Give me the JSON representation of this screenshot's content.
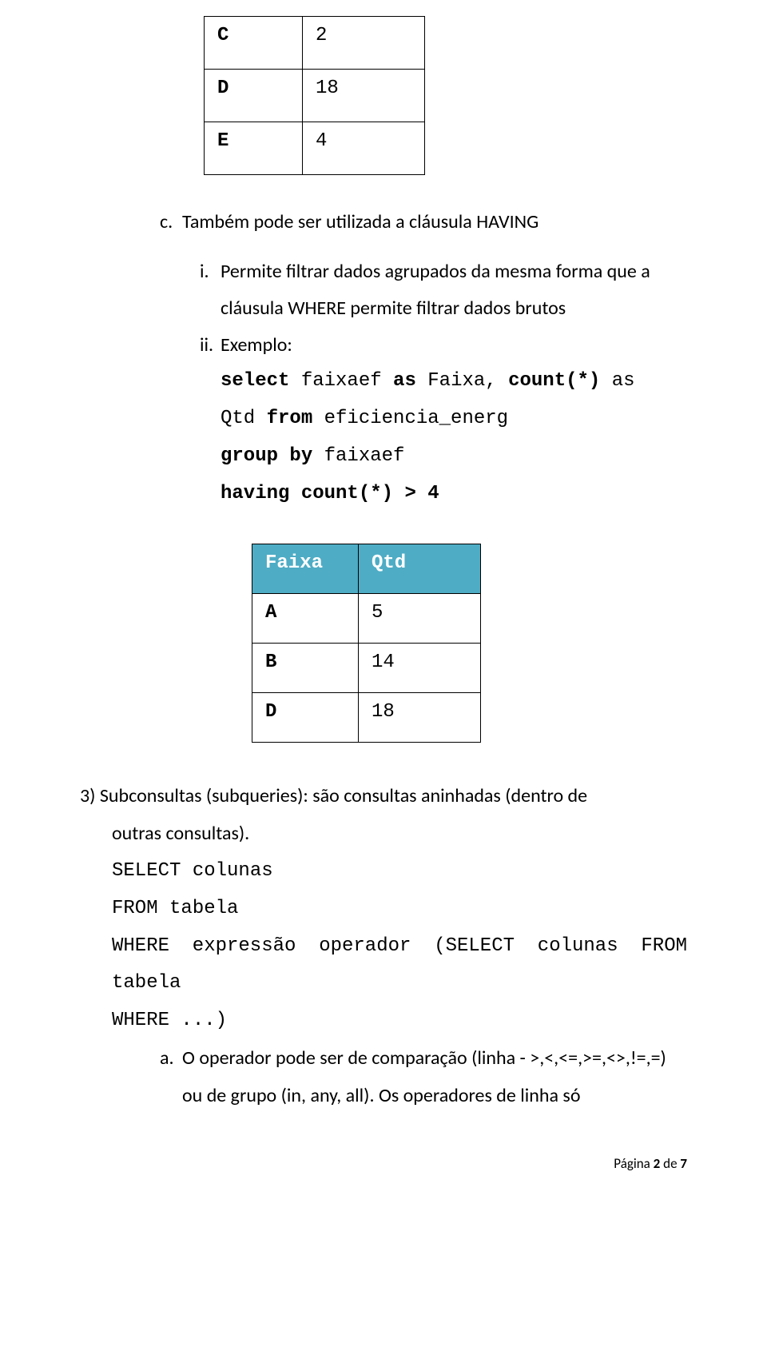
{
  "top_table": {
    "rows": [
      {
        "label": "C",
        "value": "2"
      },
      {
        "label": "D",
        "value": "18"
      },
      {
        "label": "E",
        "value": "4"
      }
    ]
  },
  "item_c": {
    "marker": "c.",
    "text": "Também pode ser utilizada a cláusula HAVING"
  },
  "sub_i": {
    "marker": "i.",
    "line1": "Permite filtrar dados agrupados da  mesma forma que a",
    "line2": "cláusula WHERE permite filtrar dados brutos"
  },
  "sub_ii": {
    "marker": "ii.",
    "text": "Exemplo:"
  },
  "code": {
    "l1_a": "select",
    "l1_b": " faixaef ",
    "l1_c": "as",
    "l1_d": " Faixa, ",
    "l1_e": "count(*)",
    "l1_f": " as",
    "l2_a": "Qtd ",
    "l2_b": "from",
    "l2_c": " eficiencia_energ",
    "l3_a": "group by",
    "l3_b": " faixaef",
    "l4": "having count(*) > 4"
  },
  "faixa_table": {
    "headers": [
      "Faixa",
      "Qtd"
    ],
    "rows": [
      {
        "label": "A",
        "value": "5"
      },
      {
        "label": "B",
        "value": "14"
      },
      {
        "label": "D",
        "value": "18"
      }
    ]
  },
  "section3": {
    "line1": "3) Subconsultas (subqueries): são consultas aninhadas (dentro de",
    "line2": "outras consultas)."
  },
  "sql": {
    "l1": "SELECT colunas",
    "l2": "FROM tabela",
    "l3": "WHERE expressão operador (SELECT colunas FROM tabela",
    "l4": "WHERE ...)"
  },
  "item_a": {
    "marker": "a.",
    "line1": "O operador pode ser de comparação (linha - >,<,<=,>=,<>,!=,=)",
    "line2": "ou de grupo (in, any, all). Os operadores de linha só"
  },
  "footer": {
    "prefix": "Página ",
    "current": "2",
    "sep": " de ",
    "total": "7"
  }
}
